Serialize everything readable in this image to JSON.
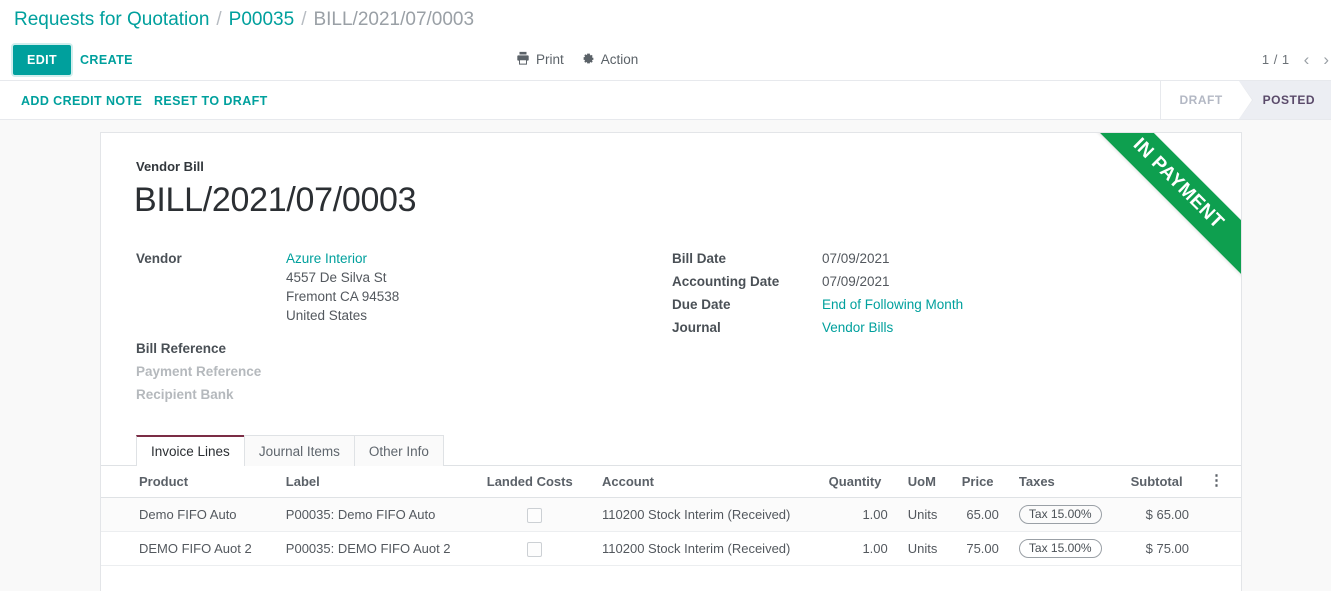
{
  "breadcrumb": {
    "items": [
      {
        "label": "Requests for Quotation",
        "active": true
      },
      {
        "label": "P00035",
        "active": true
      },
      {
        "label": "BILL/2021/07/0003",
        "active": false
      }
    ],
    "separator": "/"
  },
  "control_panel": {
    "edit_label": "EDIT",
    "create_label": "CREATE",
    "print_label": "Print",
    "print_icon": "printer-icon",
    "action_label": "Action",
    "action_icon": "gear-icon",
    "pager_count": "1 / 1",
    "prev_icon": "chevron-left-icon",
    "next_icon": "chevron-right-icon"
  },
  "status_row": {
    "add_credit_note_label": "ADD CREDIT NOTE",
    "reset_to_draft_label": "RESET TO DRAFT",
    "stages": [
      {
        "label": "DRAFT",
        "active": false
      },
      {
        "label": "POSTED",
        "active": true
      }
    ]
  },
  "sheet": {
    "ribbon": "IN PAYMENT",
    "ribbon_color": "#0e9f4f",
    "doc_type": "Vendor Bill",
    "doc_title": "BILL/2021/07/0003",
    "left_fields": {
      "vendor_label": "Vendor",
      "vendor_name": "Azure Interior",
      "address": [
        "4557 De Silva St",
        "Fremont CA 94538",
        "United States"
      ],
      "bill_reference_label": "Bill Reference",
      "bill_reference_value": "",
      "payment_reference_label": "Payment Reference",
      "payment_reference_value": "",
      "recipient_bank_label": "Recipient Bank",
      "recipient_bank_value": ""
    },
    "right_fields": [
      {
        "label": "Bill Date",
        "value": "07/09/2021",
        "link": false
      },
      {
        "label": "Accounting Date",
        "value": "07/09/2021",
        "link": false
      },
      {
        "label": "Due Date",
        "value": "End of Following Month",
        "link": true
      },
      {
        "label": "Journal",
        "value": "Vendor Bills",
        "link": true
      }
    ]
  },
  "notebook": {
    "tabs": [
      {
        "label": "Invoice Lines",
        "active": true
      },
      {
        "label": "Journal Items",
        "active": false
      },
      {
        "label": "Other Info",
        "active": false
      }
    ],
    "table": {
      "columns": [
        "Product",
        "Label",
        "Landed Costs",
        "Account",
        "Quantity",
        "UoM",
        "Price",
        "Taxes",
        "Subtotal"
      ],
      "options_icon": "vertical-dots-icon",
      "rows": [
        {
          "product": "Demo FIFO Auto",
          "label": "P00035: Demo FIFO Auto",
          "landed_costs_checked": false,
          "account": "110200 Stock Interim (Received)",
          "quantity": "1.00",
          "uom": "Units",
          "price": "65.00",
          "taxes": "Tax 15.00%",
          "subtotal": "$ 65.00"
        },
        {
          "product": "DEMO FIFO Auot 2",
          "label": "P00035: DEMO FIFO Auot 2",
          "landed_costs_checked": false,
          "account": "110200 Stock Interim (Received)",
          "quantity": "1.00",
          "uom": "Units",
          "price": "75.00",
          "taxes": "Tax 15.00%",
          "subtotal": "$ 75.00"
        }
      ]
    }
  },
  "theme": {
    "accent": "#00A09D",
    "tab_active_border": "#7b2d45",
    "ribbon_green": "#0e9f4f"
  }
}
